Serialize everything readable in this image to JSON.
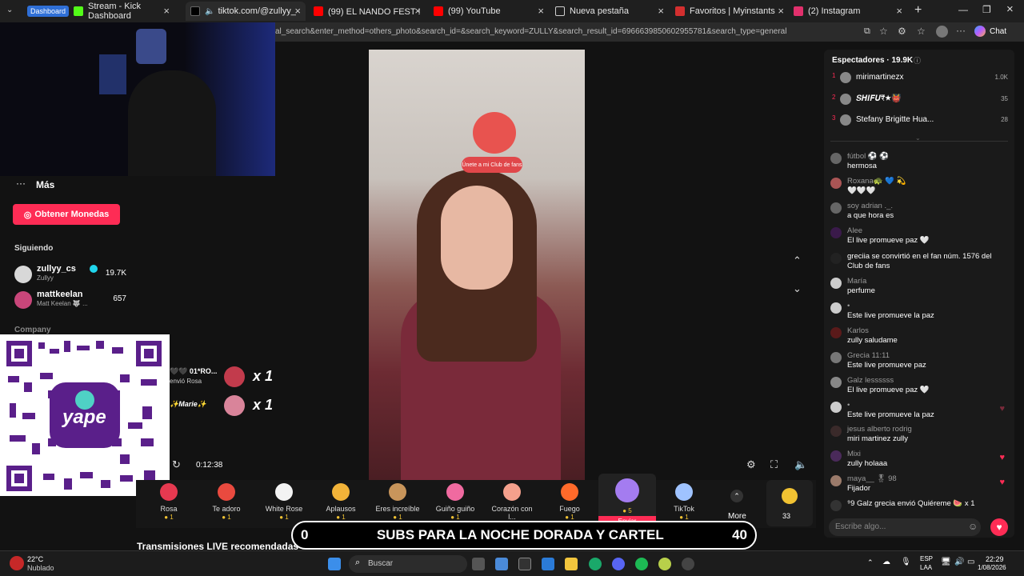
{
  "tabs": [
    {
      "label": "Dashboard",
      "is_badge": true
    },
    {
      "label": "Stream - Kick Dashboard",
      "color": "#53fc18"
    },
    {
      "label": "tiktok.com/@zullyy_cs/live",
      "color": "#ffffff",
      "active": true
    },
    {
      "label": "(99) EL NANDO FEST !! 😃 🍾 🎉 😌",
      "color": "#ff0000"
    },
    {
      "label": "(99) YouTube",
      "color": "#ff0000"
    },
    {
      "label": "Nueva pestaña",
      "color": "#cfcfcf"
    },
    {
      "label": "Favoritos | Myinstants",
      "color": "#d32f2f"
    },
    {
      "label": "(2) Instagram",
      "color": "#e1306c"
    }
  ],
  "address_bar": {
    "url": "al_search&enter_method=others_photo&search_id=&search_keyword=ZULLY&search_result_id=6966639850602955781&search_type=general",
    "chat_label": "Chat"
  },
  "sidebar": {
    "more_label": "Más",
    "coins_button": "Obtener Monedas",
    "following_title": "Siguiendo",
    "following": [
      {
        "name": "zullyy_cs",
        "sub": "Zullyy",
        "count": "19.7K",
        "verified": true
      },
      {
        "name": "mattkeelan",
        "sub": "Matt Keelan 🐺 ...",
        "count": "657"
      }
    ],
    "company_label": "Company"
  },
  "qr": {
    "brand": "yape"
  },
  "video": {
    "club_badge": "Únete a mi Club de fans",
    "timer": "0:12:38"
  },
  "gifters": [
    {
      "name": "🖤🖤 01*RO...",
      "sub": "envió Rosa",
      "mult": "x 1"
    },
    {
      "name": "✨Marie✨",
      "sub": "",
      "mult": "x 1"
    }
  ],
  "gifts": [
    {
      "name": "Rosa",
      "cost": "1",
      "color": "#e63950"
    },
    {
      "name": "Te adoro",
      "cost": "1",
      "color": "#e94a3f"
    },
    {
      "name": "White Rose",
      "cost": "1",
      "color": "#f3f3f3"
    },
    {
      "name": "Aplausos",
      "cost": "1",
      "color": "#f2b339"
    },
    {
      "name": "Eres increíble",
      "cost": "1",
      "color": "#c8955b"
    },
    {
      "name": "Guiño guiño",
      "cost": "1",
      "color": "#f06aa0"
    },
    {
      "name": "Corazón con l...",
      "cost": "5",
      "color": "#f4a08c"
    },
    {
      "name": "Fuego",
      "cost": "1",
      "color": "#ff6a2a"
    },
    {
      "name": "",
      "cost": "5",
      "color": "#a47cf0",
      "send_label": "Enviar"
    },
    {
      "name": "TikTok",
      "cost": "1",
      "color": "#9fc3ff"
    }
  ],
  "gift_more": "More",
  "coins_count": "33",
  "related_title": "Transmisiones LIVE recomendadas",
  "chat": {
    "viewers_title": "Espectadores · 19.9K",
    "top_viewers": [
      {
        "rank": "1",
        "name": "mirimartinezx",
        "count": "1.0K"
      },
      {
        "rank": "2",
        "name": "𝑺𝑯𝑰𝑭𝑼₹★👹",
        "count": "35"
      },
      {
        "rank": "3",
        "name": "Stefany Brigitte Hua...",
        "count": "28"
      }
    ],
    "messages": [
      {
        "user": "fútbol ⚽ ⚽",
        "text": "hermosa"
      },
      {
        "user": "Roxana🐢 💙 💫",
        "text": "🤍🤍🤍"
      },
      {
        "user": "soy adrian ._.",
        "text": "a que hora es"
      },
      {
        "user": "Alee",
        "text": "El live promueve paz 🤍"
      },
      {
        "user": "",
        "text": "greciia se convirtió en el fan núm. 1576 del Club de fans"
      },
      {
        "user": "María",
        "text": "perfume"
      },
      {
        "user": "•",
        "text": "Este live promueve la paz"
      },
      {
        "user": "Karlos",
        "text": "zully saludame"
      },
      {
        "user": "Grecia 11:11",
        "text": "Este live promueve paz"
      },
      {
        "user": "Galz lessssss",
        "text": "El live promueve paz 🤍"
      },
      {
        "user": "•",
        "text": "Este live promueve la paz"
      },
      {
        "user": "jesus alberto rodrig",
        "text": "miri martinez zully"
      },
      {
        "user": "Mixi",
        "text": "zully holaaa"
      },
      {
        "user": "maya__ 🎖 98",
        "text": "Fijador"
      },
      {
        "user": "",
        "text": "⁹9 Galz grecia envió Quiéreme 🍉 x 1"
      }
    ],
    "input_placeholder": "Escribe algo..."
  },
  "banner": {
    "left": "0",
    "text": "SUBS PARA LA NOCHE DORADA Y CARTEL",
    "right": "40"
  },
  "taskbar": {
    "weather_temp": "22°C",
    "weather_desc": "Nublado",
    "search": "Buscar",
    "lang1": "ESP",
    "lang2": "LAA",
    "time": "22:29",
    "date": "1/08/2026"
  }
}
